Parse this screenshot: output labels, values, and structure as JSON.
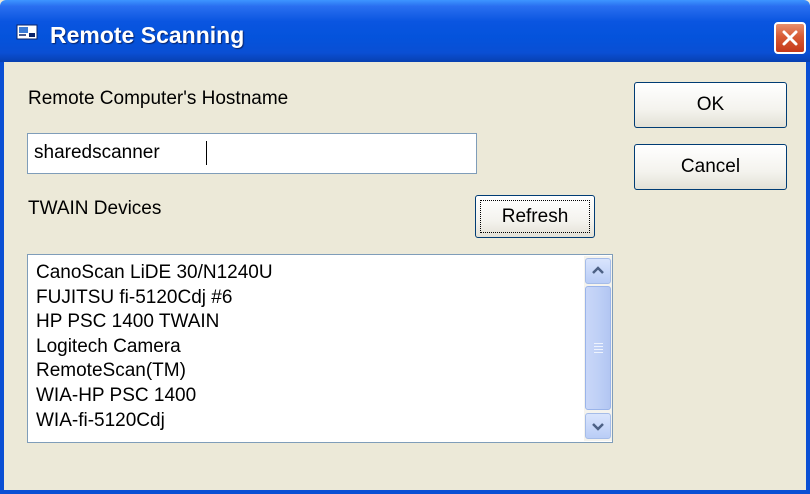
{
  "window": {
    "title": "Remote Scanning",
    "close_label": "✕"
  },
  "form": {
    "hostname_label": "Remote Computer's Hostname",
    "hostname_value": "sharedscanner",
    "devices_label": "TWAIN Devices",
    "refresh_label": "Refresh",
    "ok_label": "OK",
    "cancel_label": "Cancel"
  },
  "devices": [
    "CanoScan LiDE 30/N1240U",
    "FUJITSU fi-5120Cdj #6",
    "HP PSC 1400 TWAIN",
    "Logitech Camera",
    "RemoteScan(TM)",
    "WIA-HP PSC 1400",
    "WIA-fi-5120Cdj"
  ],
  "icons": {
    "title": "scanner-app-icon",
    "close": "close-icon",
    "scroll_up": "chevron-up-icon",
    "scroll_down": "chevron-down-icon"
  },
  "colors": {
    "titlebar": "#0453dc",
    "dialog_bg": "#ece9d8",
    "close_button": "#d85a33",
    "button_border": "#003c74"
  }
}
